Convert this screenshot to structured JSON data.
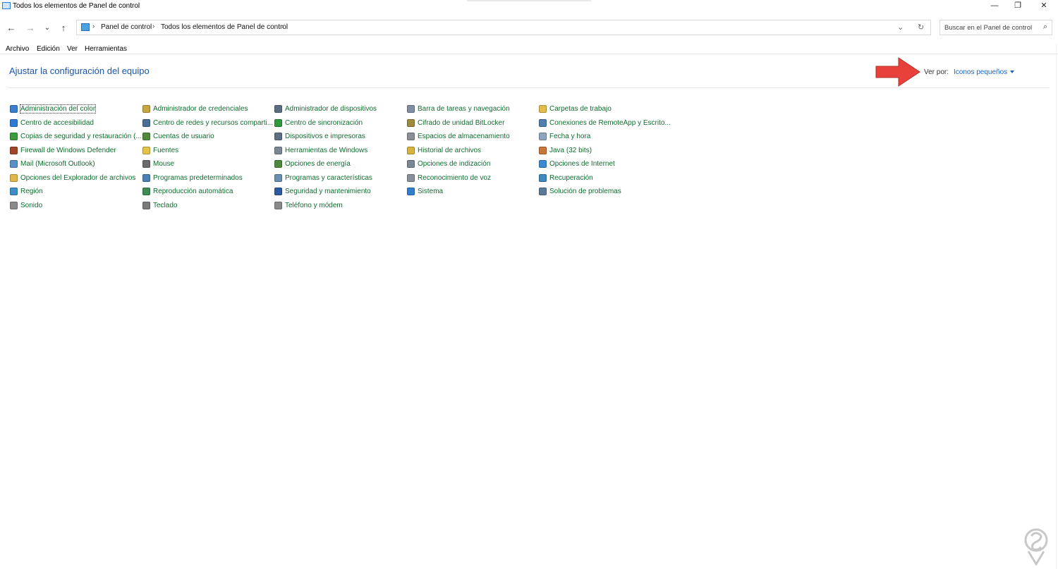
{
  "window": {
    "title": "Todos los elementos de Panel de control",
    "minimize": "—",
    "restore": "❐",
    "close": "✕"
  },
  "nav": {
    "back": "←",
    "forward": "→",
    "recent": "⌄",
    "up": "↑",
    "breadcrumb": [
      "Panel de control",
      "Todos los elementos de Panel de control"
    ],
    "crumb_separator": "›",
    "dropdown": "⌄",
    "refresh": "↻",
    "search_placeholder": "Buscar en el Panel de control",
    "search_icon": "⌕"
  },
  "menu": [
    "Archivo",
    "Edición",
    "Ver",
    "Herramientas"
  ],
  "heading": "Ajustar la configuración del equipo",
  "view_by": {
    "label": "Ver por:",
    "value": "Iconos pequeños"
  },
  "columns": [
    [
      {
        "label": "Administración del color",
        "icon": "color-management-icon",
        "color": "#3b7fd0"
      },
      {
        "label": "Centro de accesibilidad",
        "icon": "accessibility-icon",
        "color": "#2f79d6"
      },
      {
        "label": "Copias de seguridad y restauración (...",
        "icon": "backup-icon",
        "color": "#3c9b3c"
      },
      {
        "label": "Firewall de Windows Defender",
        "icon": "firewall-icon",
        "color": "#a0462a"
      },
      {
        "label": "Mail (Microsoft Outlook)",
        "icon": "mail-icon",
        "color": "#5a8fc8"
      },
      {
        "label": "Opciones del Explorador de archivos",
        "icon": "folder-options-icon",
        "color": "#e0b84a"
      },
      {
        "label": "Región",
        "icon": "region-icon",
        "color": "#3c8ec9"
      },
      {
        "label": "Sonido",
        "icon": "sound-icon",
        "color": "#8a8a8a"
      }
    ],
    [
      {
        "label": "Administrador de credenciales",
        "icon": "credentials-icon",
        "color": "#c9a640"
      },
      {
        "label": "Centro de redes y recursos comparti...",
        "icon": "network-icon",
        "color": "#4a6f96"
      },
      {
        "label": "Cuentas de usuario",
        "icon": "user-accounts-icon",
        "color": "#4f8a3c"
      },
      {
        "label": "Fuentes",
        "icon": "fonts-icon",
        "color": "#e5c34a"
      },
      {
        "label": "Mouse",
        "icon": "mouse-icon",
        "color": "#6b6b6b"
      },
      {
        "label": "Programas predeterminados",
        "icon": "default-programs-icon",
        "color": "#4a7fb5"
      },
      {
        "label": "Reproducción automática",
        "icon": "autoplay-icon",
        "color": "#3f8b55"
      },
      {
        "label": "Teclado",
        "icon": "keyboard-icon",
        "color": "#7a7a7a"
      }
    ],
    [
      {
        "label": "Administrador de dispositivos",
        "icon": "device-manager-icon",
        "color": "#5b6d82"
      },
      {
        "label": "Centro de sincronización",
        "icon": "sync-icon",
        "color": "#2e9a3c"
      },
      {
        "label": "Dispositivos e impresoras",
        "icon": "printers-icon",
        "color": "#5d6f84"
      },
      {
        "label": "Herramientas de Windows",
        "icon": "windows-tools-icon",
        "color": "#7a8794"
      },
      {
        "label": "Opciones de energía",
        "icon": "power-icon",
        "color": "#4e8a3c"
      },
      {
        "label": "Programas y características",
        "icon": "programs-icon",
        "color": "#6a8fb0"
      },
      {
        "label": "Seguridad y mantenimiento",
        "icon": "security-flag-icon",
        "color": "#2b5aa0"
      },
      {
        "label": "Teléfono y módem",
        "icon": "phone-modem-icon",
        "color": "#8a8a8a"
      }
    ],
    [
      {
        "label": "Barra de tareas y navegación",
        "icon": "taskbar-icon",
        "color": "#7e8fa3"
      },
      {
        "label": "Cifrado de unidad BitLocker",
        "icon": "bitlocker-icon",
        "color": "#a08a3c"
      },
      {
        "label": "Espacios de almacenamiento",
        "icon": "storage-spaces-icon",
        "color": "#8a8f96"
      },
      {
        "label": "Historial de archivos",
        "icon": "file-history-icon",
        "color": "#d9b43c"
      },
      {
        "label": "Opciones de indización",
        "icon": "indexing-icon",
        "color": "#7a8796"
      },
      {
        "label": "Reconocimiento de voz",
        "icon": "microphone-icon",
        "color": "#8a9099"
      },
      {
        "label": "Sistema",
        "icon": "system-icon",
        "color": "#2f7fd0"
      }
    ],
    [
      {
        "label": "Carpetas de trabajo",
        "icon": "work-folders-icon",
        "color": "#e2bd4a"
      },
      {
        "label": "Conexiones de RemoteApp y Escrito...",
        "icon": "remoteapp-icon",
        "color": "#4f7fb0"
      },
      {
        "label": "Fecha y hora",
        "icon": "date-time-icon",
        "color": "#8fa5bd"
      },
      {
        "label": "Java (32 bits)",
        "icon": "java-icon",
        "color": "#c9763a"
      },
      {
        "label": "Opciones de Internet",
        "icon": "internet-options-icon",
        "color": "#3a8ad0"
      },
      {
        "label": "Recuperación",
        "icon": "recovery-icon",
        "color": "#3c8ac0"
      },
      {
        "label": "Solución de problemas",
        "icon": "troubleshooting-icon",
        "color": "#5a7a9a"
      }
    ]
  ],
  "annotation_arrow_color": "#e8403a"
}
